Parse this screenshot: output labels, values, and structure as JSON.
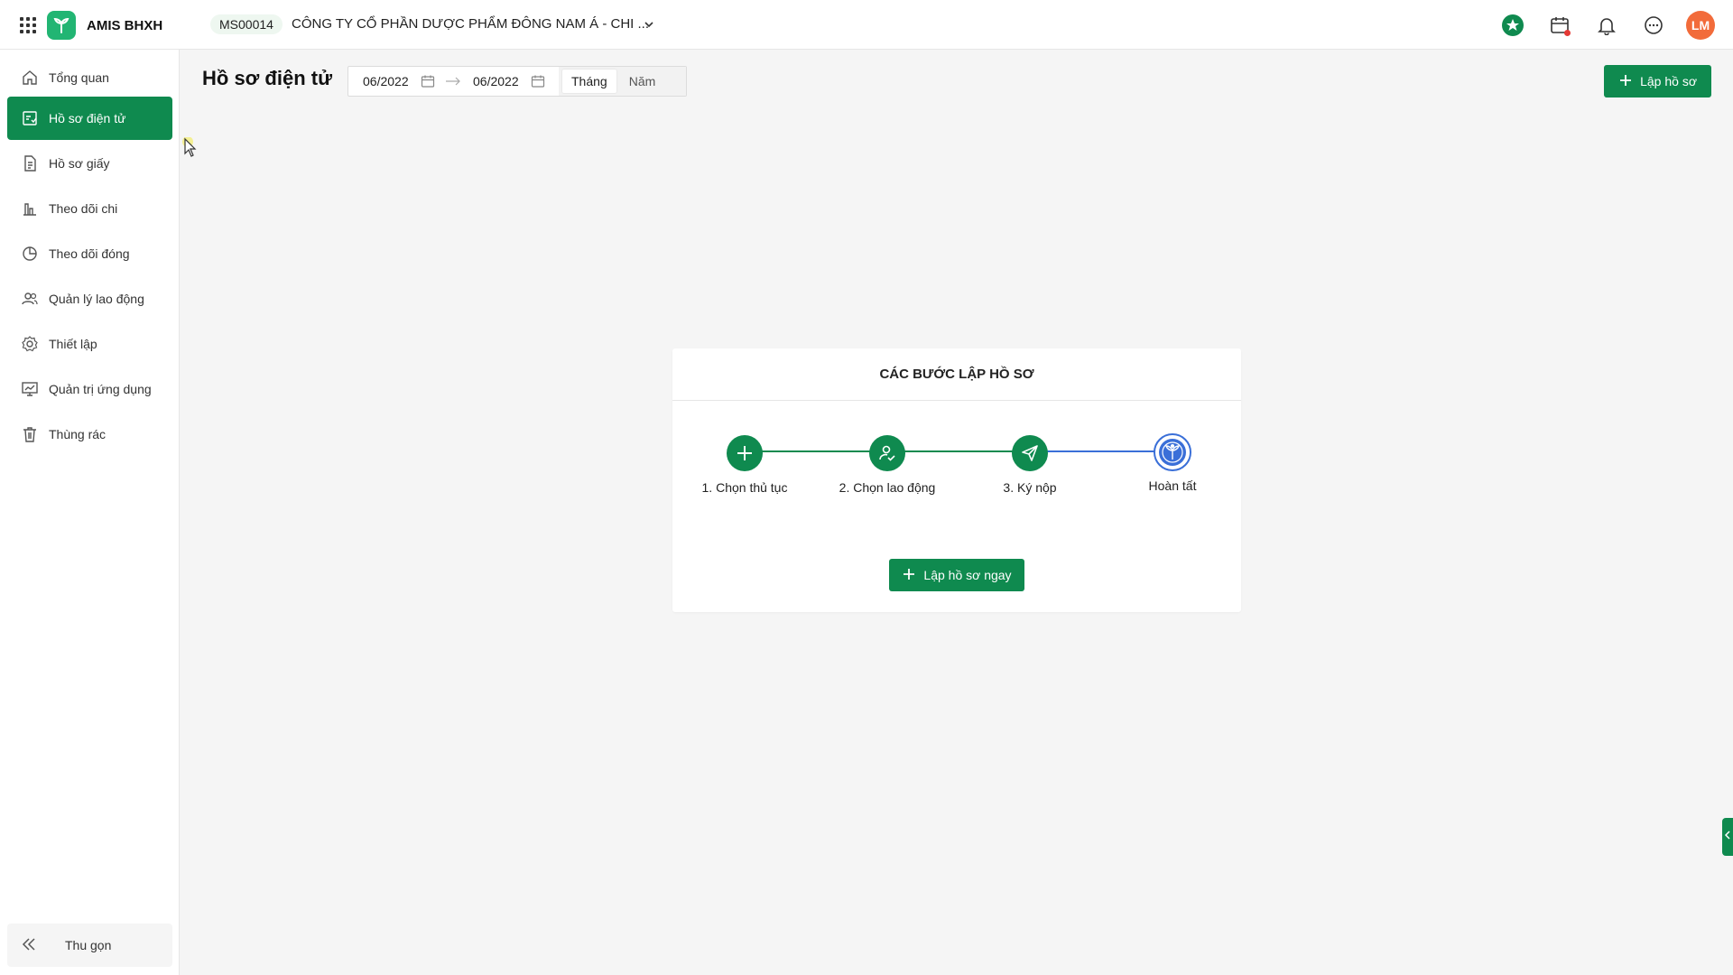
{
  "app": {
    "brand_name": "AMIS BHXH",
    "company_code": "MS00014",
    "company_name": "CÔNG TY CỔ PHẦN DƯỢC PHẨM ĐÔNG NAM Á - CHI ...",
    "user_initials": "LM",
    "accent_color": "#0f8a4f",
    "avatar_color": "#f26b3a"
  },
  "sidebar": {
    "items": [
      {
        "label": "Tổng quan",
        "icon": "home-icon"
      },
      {
        "label": "Hồ sơ điện tử",
        "icon": "edocument-icon"
      },
      {
        "label": "Hồ sơ giấy",
        "icon": "paper-document-icon"
      },
      {
        "label": "Theo dõi chi",
        "icon": "bar-chart-icon"
      },
      {
        "label": "Theo dõi đóng",
        "icon": "pie-chart-icon"
      },
      {
        "label": "Quản lý lao động",
        "icon": "users-icon"
      },
      {
        "label": "Thiết lập",
        "icon": "gear-icon"
      },
      {
        "label": "Quản trị ứng dụng",
        "icon": "monitor-chart-icon"
      },
      {
        "label": "Thùng rác",
        "icon": "trash-icon"
      }
    ],
    "active_index": 1,
    "collapse_label": "Thu gọn"
  },
  "header": {
    "title": "Hồ sơ điện tử",
    "date_from": "06/2022",
    "date_to": "06/2022",
    "period_options": [
      "Tháng",
      "Năm"
    ],
    "period_selected": "Tháng",
    "create_button": "Lập hồ sơ"
  },
  "steps_card": {
    "title": "CÁC BƯỚC LẬP HỒ SƠ",
    "steps": [
      {
        "label": "1. Chọn thủ tục",
        "icon": "plus-icon"
      },
      {
        "label": "2. Chọn lao động",
        "icon": "user-check-icon"
      },
      {
        "label": "3. Ký nộp",
        "icon": "send-icon"
      },
      {
        "label": "Hoàn tất",
        "icon": "bhxh-logo-icon"
      }
    ],
    "create_now_button": "Lập hồ sơ ngay"
  }
}
